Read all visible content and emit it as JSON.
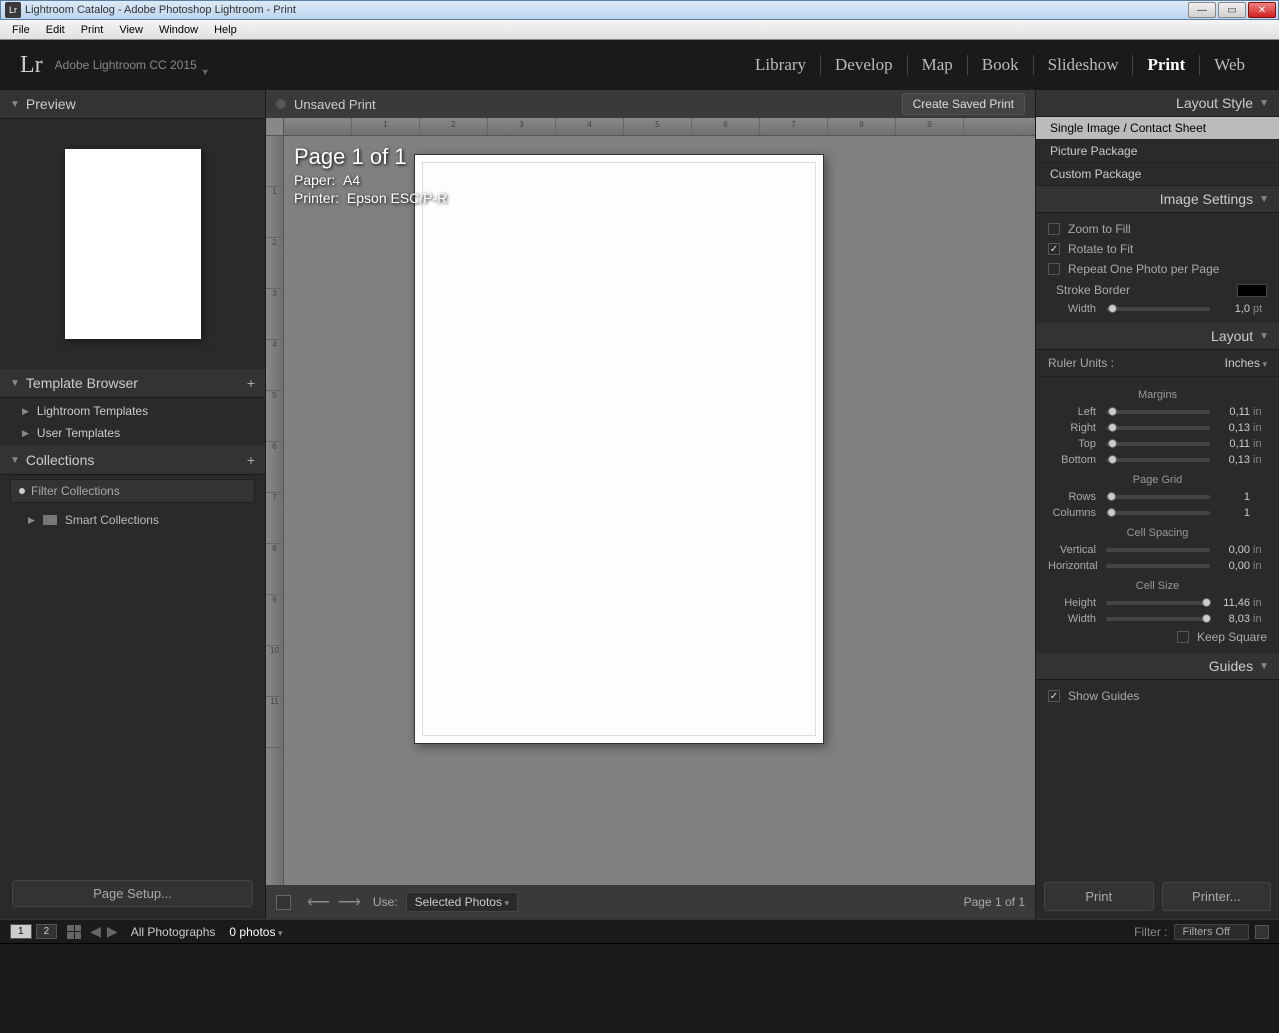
{
  "window": {
    "title": "Lightroom Catalog - Adobe Photoshop Lightroom - Print",
    "app_icon": "Lr"
  },
  "menu": {
    "file": "File",
    "edit": "Edit",
    "print": "Print",
    "view": "View",
    "window": "Window",
    "help": "Help"
  },
  "header": {
    "logo": "Lr",
    "brand": "Adobe Lightroom CC 2015",
    "modules": {
      "library": "Library",
      "develop": "Develop",
      "map": "Map",
      "book": "Book",
      "slideshow": "Slideshow",
      "print": "Print",
      "web": "Web"
    }
  },
  "left": {
    "preview": {
      "title": "Preview"
    },
    "template_browser": {
      "title": "Template Browser",
      "lightroom": "Lightroom Templates",
      "user": "User Templates"
    },
    "collections": {
      "title": "Collections",
      "filter_placeholder": "Filter Collections",
      "smart": "Smart Collections"
    },
    "page_setup": "Page Setup..."
  },
  "center": {
    "title": "Unsaved Print",
    "create_saved": "Create Saved Print",
    "page_label": "Page 1 of 1",
    "paper_label": "Paper:",
    "paper_value": "A4",
    "printer_label": "Printer:",
    "printer_value": "Epson ESC/P-R",
    "use_label": "Use:",
    "use_value": "Selected Photos",
    "page_info": "Page 1 of 1"
  },
  "right": {
    "layout_style": {
      "title": "Layout Style",
      "single": "Single Image / Contact Sheet",
      "picture": "Picture Package",
      "custom": "Custom Package"
    },
    "image_settings": {
      "title": "Image Settings",
      "zoom": "Zoom to Fill",
      "rotate": "Rotate to Fit",
      "repeat": "Repeat One Photo per Page",
      "stroke": "Stroke Border",
      "width_label": "Width",
      "width_val": "1,0",
      "width_unit": "pt"
    },
    "layout": {
      "title": "Layout",
      "ruler_units_label": "Ruler Units :",
      "ruler_units_value": "Inches",
      "margins_label": "Margins",
      "left": {
        "label": "Left",
        "val": "0,11",
        "unit": "in"
      },
      "right": {
        "label": "Right",
        "val": "0,13",
        "unit": "in"
      },
      "top": {
        "label": "Top",
        "val": "0,11",
        "unit": "in"
      },
      "bottom": {
        "label": "Bottom",
        "val": "0,13",
        "unit": "in"
      },
      "page_grid_label": "Page Grid",
      "rows": {
        "label": "Rows",
        "val": "1"
      },
      "columns": {
        "label": "Columns",
        "val": "1"
      },
      "cell_spacing_label": "Cell Spacing",
      "vertical": {
        "label": "Vertical",
        "val": "0,00",
        "unit": "in"
      },
      "horizontal": {
        "label": "Horizontal",
        "val": "0,00",
        "unit": "in"
      },
      "cell_size_label": "Cell Size",
      "height": {
        "label": "Height",
        "val": "11,46",
        "unit": "in"
      },
      "width": {
        "label": "Width",
        "val": "8,03",
        "unit": "in"
      },
      "keep_square": "Keep Square"
    },
    "guides": {
      "title": "Guides",
      "show": "Show Guides"
    },
    "print_btn": "Print",
    "printer_btn": "Printer..."
  },
  "filmstrip": {
    "view1": "1",
    "view2": "2",
    "path": "All Photographs",
    "count": "0 photos",
    "filter_label": "Filter :",
    "filter_value": "Filters Off"
  }
}
